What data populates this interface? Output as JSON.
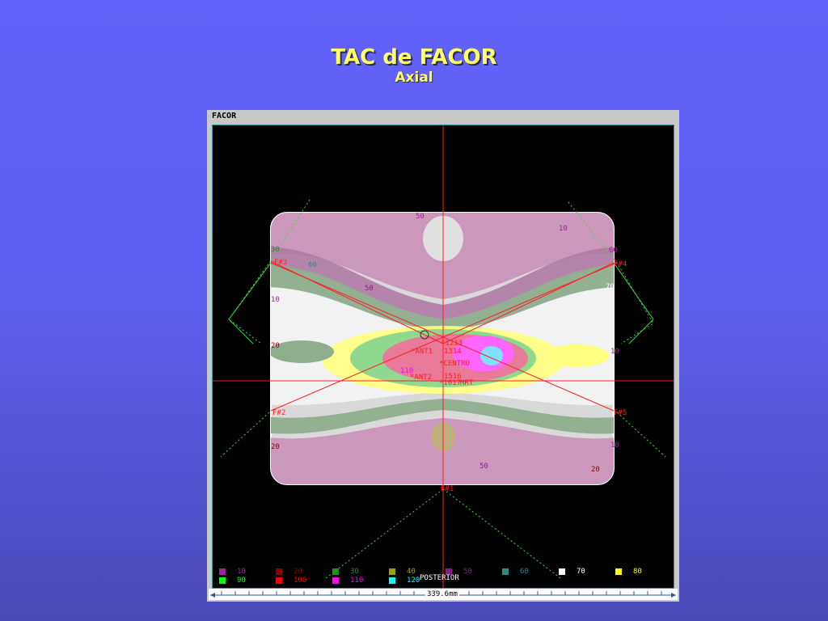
{
  "slide": {
    "title": "TAC  de FACOR",
    "subtitle": "Axial"
  },
  "window": {
    "title": "FACOR"
  },
  "orientation": {
    "posterior": "POSTERIOR"
  },
  "fields": [
    {
      "label": "F#1"
    },
    {
      "label": "F#2"
    },
    {
      "label": "F#3"
    },
    {
      "label": "F#4"
    },
    {
      "label": "F#5"
    }
  ],
  "points": [
    {
      "label": "*1213"
    },
    {
      "label": "*ANT1"
    },
    {
      "label": "1314"
    },
    {
      "label": "*CENTRO"
    },
    {
      "label": "*ANT2"
    },
    {
      "label": "1516"
    },
    {
      "label": "*1617"
    },
    {
      "label": "MRT"
    }
  ],
  "isodose_labels": [
    {
      "text": "50"
    },
    {
      "text": "60"
    },
    {
      "text": "50"
    },
    {
      "text": "10"
    },
    {
      "text": "60"
    },
    {
      "text": "70"
    },
    {
      "text": "10"
    },
    {
      "text": "110"
    },
    {
      "text": "20"
    },
    {
      "text": "10"
    },
    {
      "text": "50"
    },
    {
      "text": "20"
    },
    {
      "text": "30"
    },
    {
      "text": "10"
    },
    {
      "text": "20"
    }
  ],
  "legend": [
    {
      "value": "10",
      "color": "#a020a0",
      "text_color": "#a020a0"
    },
    {
      "value": "20",
      "color": "#8b0000",
      "text_color": "#8b0000"
    },
    {
      "value": "30",
      "color": "#1f8f1f",
      "text_color": "#1f8f1f"
    },
    {
      "value": "40",
      "color": "#a0a000",
      "text_color": "#a0a000"
    },
    {
      "value": "50",
      "color": "#8a1a8a",
      "text_color": "#8a1a8a"
    },
    {
      "value": "60",
      "color": "#2a8a8a",
      "text_color": "#2a8a8a"
    },
    {
      "value": "70",
      "color": "#ffffff",
      "text_color": "#ffffff"
    },
    {
      "value": "80",
      "color": "#ffff00",
      "text_color": "#ffff00"
    },
    {
      "value": "90",
      "color": "#00ff00",
      "text_color": "#00ff00"
    },
    {
      "value": "100",
      "color": "#ff0000",
      "text_color": "#ff0000"
    },
    {
      "value": "110",
      "color": "#ff00ff",
      "text_color": "#ff00ff"
    },
    {
      "value": "120",
      "color": "#00ffff",
      "text_color": "#00ffff"
    }
  ],
  "scale": {
    "label": "339.6mm"
  }
}
